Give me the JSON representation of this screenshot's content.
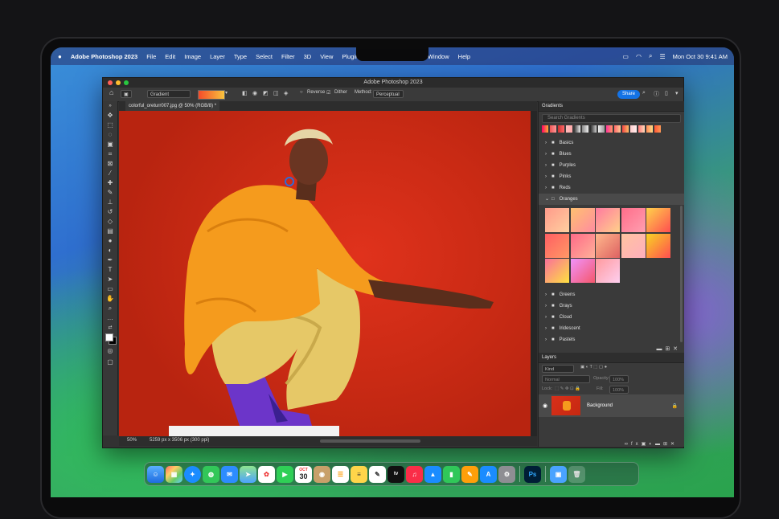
{
  "menubar": {
    "apple": "",
    "app": "Adobe Photoshop 2023",
    "items": [
      "File",
      "Edit",
      "Image",
      "Layer",
      "Type",
      "Select",
      "Filter",
      "3D",
      "View",
      "Plugins"
    ],
    "items_right_of_notch": [
      "Window",
      "Help"
    ],
    "clock": "Mon Oct 30  9:41 AM"
  },
  "window": {
    "title": "Adobe Photoshop 2023",
    "options": {
      "tool_preset": "Gradient",
      "reverse_label": "Reverse",
      "dither_label": "Dither",
      "method_label": "Method:",
      "method_value": "Perceptual",
      "share_label": "Share"
    },
    "document_tab": "colorful_oreturr007.jpg @ 50% (RGB/8) *",
    "status": {
      "zoom": "50%",
      "dimensions": "5259 px x 3506 px (300 ppi)"
    }
  },
  "gradients_panel": {
    "title": "Gradients",
    "search_placeholder": "Search Gradients",
    "folders_top": [
      "Basics",
      "Blues",
      "Purples",
      "Pinks",
      "Reds"
    ],
    "open_folder": "Oranges",
    "folders_bottom": [
      "Greens",
      "Grays",
      "Cloud",
      "Iridescent",
      "Pastels"
    ]
  },
  "layers_panel": {
    "title": "Layers",
    "kind_label": "Kind",
    "blend_mode": "Normal",
    "opacity_label": "Opacity:",
    "opacity_value": "100%",
    "lock_label": "Lock:",
    "fill_label": "Fill:",
    "fill_value": "100%",
    "layer_name": "Background"
  },
  "dock": {
    "calendar_month": "OCT",
    "calendar_day": "30",
    "photoshop_label": "Ps",
    "tv_label": "tv"
  },
  "colors": {
    "accent": "#1473e6",
    "canvas_red": "#d32e18"
  }
}
